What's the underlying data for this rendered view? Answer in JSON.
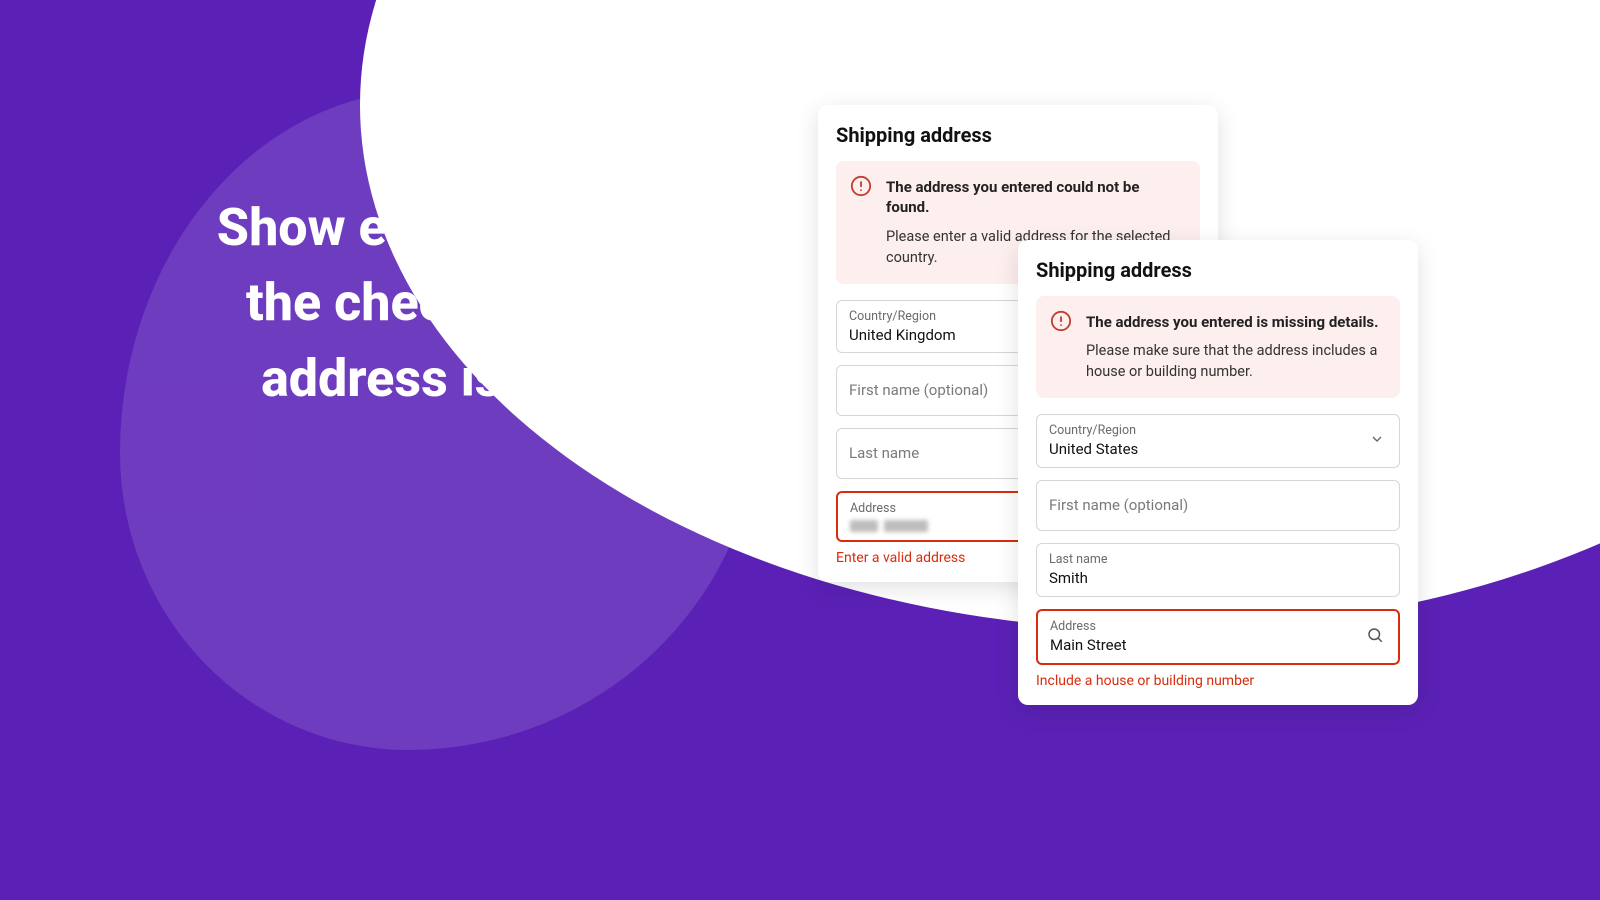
{
  "headline": "Show error and block the checkout if the address is invalid",
  "cardA": {
    "title": "Shipping address",
    "alert": {
      "title": "The address you entered could not be found.",
      "body": "Please enter a valid address for the selected country."
    },
    "country": {
      "label": "Country/Region",
      "value": "United Kingdom"
    },
    "firstName": {
      "placeholder": "First name (optional)"
    },
    "lastName": {
      "placeholder": "Last name"
    },
    "address": {
      "label": "Address"
    },
    "errorText": "Enter a valid address"
  },
  "cardB": {
    "title": "Shipping address",
    "alert": {
      "title": "The address you entered is missing details.",
      "body": "Please make sure that the address includes a house or building number."
    },
    "country": {
      "label": "Country/Region",
      "value": "United States"
    },
    "firstName": {
      "placeholder": "First name (optional)"
    },
    "lastName": {
      "label": "Last name",
      "value": "Smith"
    },
    "address": {
      "label": "Address",
      "value": "Main Street"
    },
    "errorText": "Include a house or building number"
  }
}
